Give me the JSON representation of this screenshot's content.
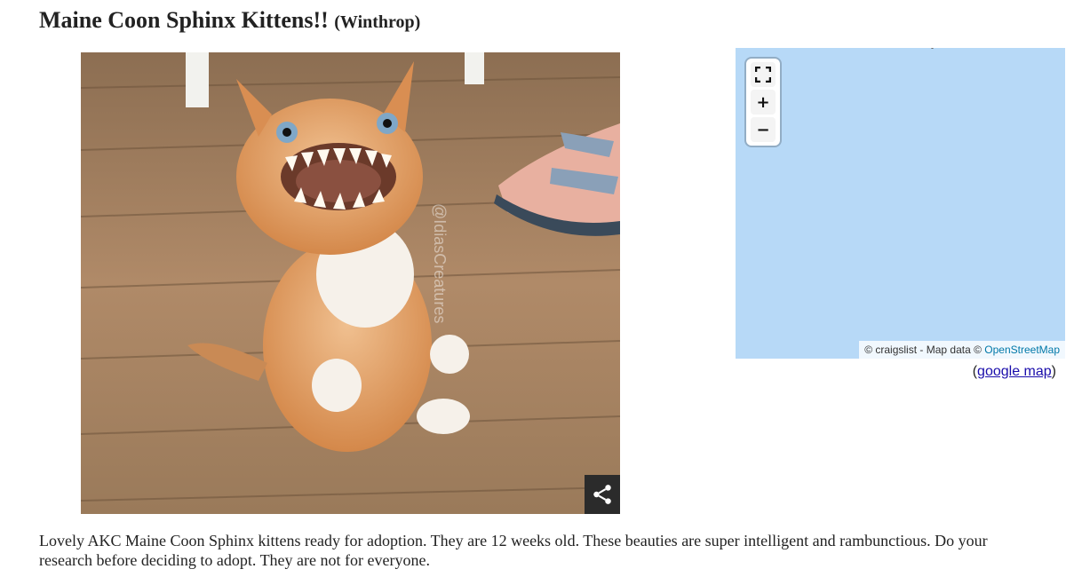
{
  "posting": {
    "title": "Maine Coon Sphinx Kittens!!",
    "location": "(Winthrop)",
    "description": "Lovely AKC Maine Coon Sphinx kittens ready for adoption. They are 12 weeks old. These beauties are super intelligent and rambunctious. Do your research before deciding to adopt. They are not for everyone."
  },
  "photo": {
    "alt": "kitten photo",
    "watermark": "@IdiasCreatures",
    "share_icon": "share-icon"
  },
  "map": {
    "fullscreen_icon": "fullscreen-icon",
    "zoom_in_label": "+",
    "zoom_out_label": "−",
    "attribution_prefix": "© craigslist - Map data ©",
    "attribution_link": "OpenStreetMap",
    "google_map_open": "(",
    "google_map_link": "google map",
    "google_map_close": ")",
    "water_color": "#b7d9f7"
  }
}
